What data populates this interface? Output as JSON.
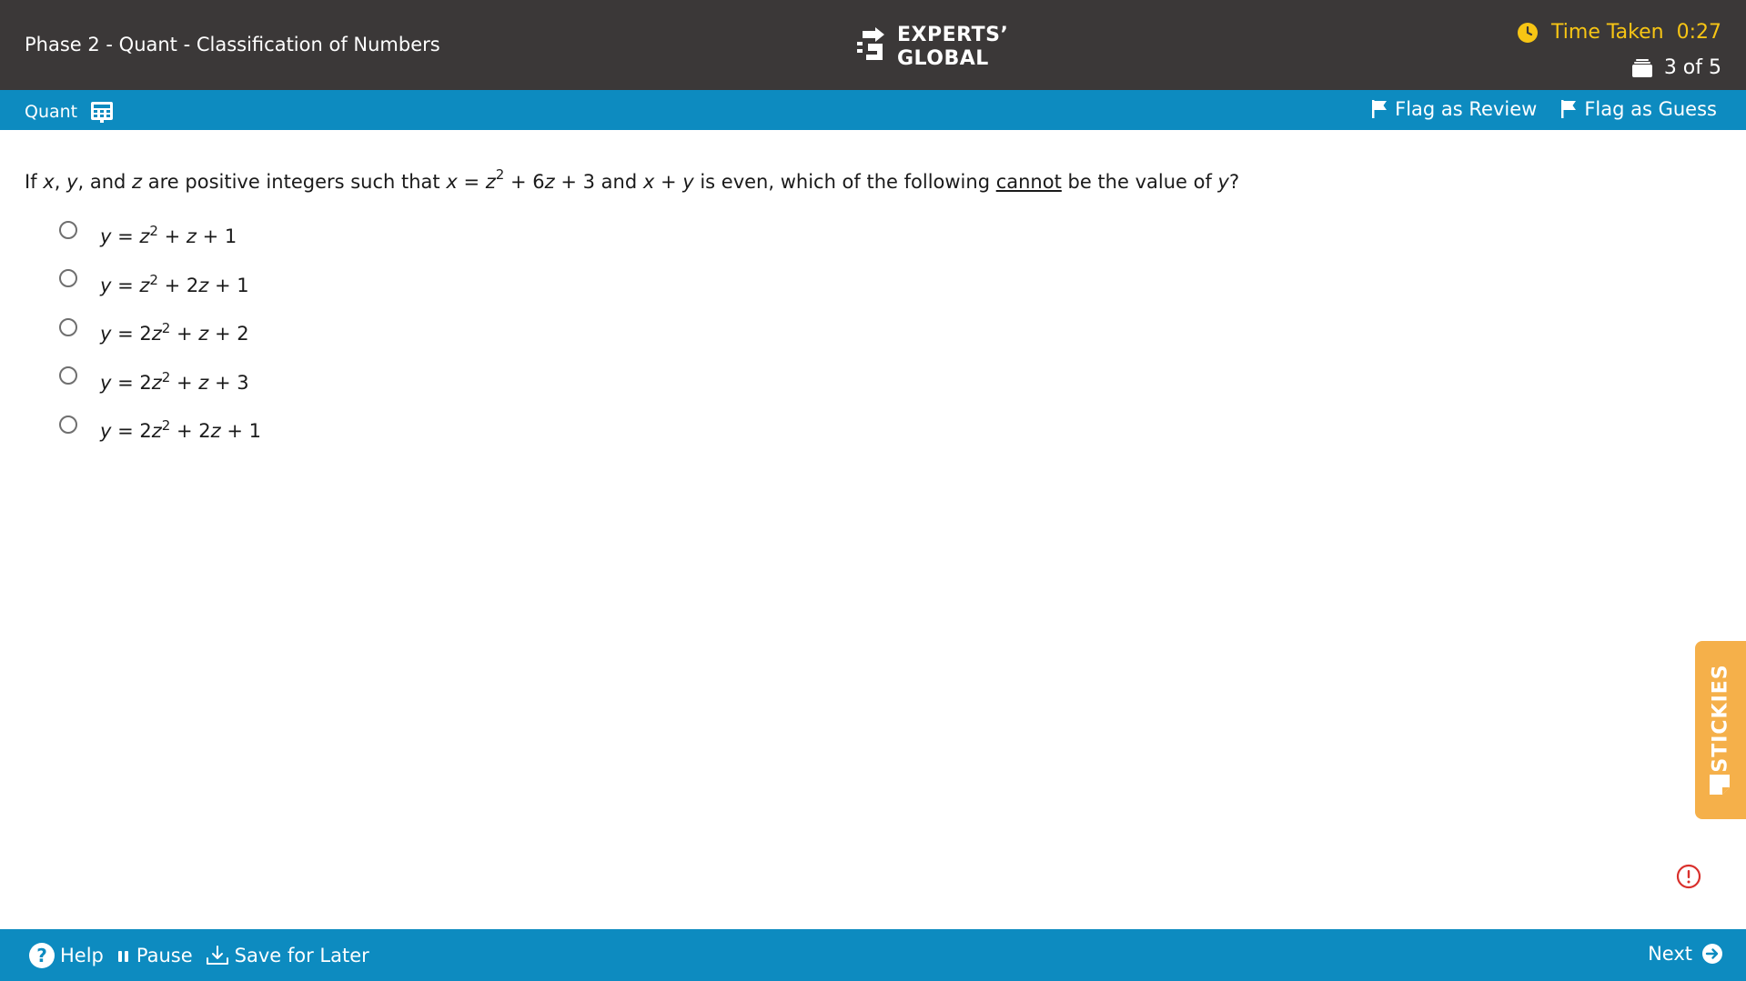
{
  "header": {
    "title": "Phase 2 - Quant - Classification of Numbers",
    "logo": {
      "line1": "EXPERTS’",
      "line2": "GLOBAL",
      "icon": "experts-global-logo-icon"
    },
    "timer": {
      "label": "Time Taken",
      "value": "0:27",
      "icon": "clock-icon",
      "color": "#f7c514"
    },
    "progress": {
      "text": "3 of 5",
      "icon": "question-stack-icon"
    },
    "background": "#3b3838"
  },
  "subbar": {
    "section": "Quant",
    "section_icon": "calculator-icon",
    "flag_review": "Flag as Review",
    "flag_guess": "Flag as Guess",
    "background": "#0d8bc0"
  },
  "question": {
    "p1": "If ",
    "var_x": "x",
    "c1": ", ",
    "var_y": "y",
    "c2": ", and ",
    "var_z": "z",
    "p2": " are positive integers such that ",
    "eq_x": "x",
    "eq_mid": " = ",
    "eq_z": "z",
    "eq_exp": "2",
    "eq_rest1": " + 6",
    "eq_z2": "z",
    "eq_rest2": " + 3 and ",
    "sum_x": "x",
    "sum_plus": " + ",
    "sum_y": "y",
    "p3": " is even, which of the following ",
    "emph": "cannot",
    "p4": " be the value of ",
    "end_y": "y",
    "end": "?"
  },
  "options": [
    {
      "y": "y",
      "eq": " = ",
      "coef": "",
      "z": "z",
      "exp": "2",
      "mid": " + ",
      "coef2": "",
      "z2": "z",
      "tail": " + 1"
    },
    {
      "y": "y",
      "eq": " = ",
      "coef": "",
      "z": "z",
      "exp": "2",
      "mid": " + ",
      "coef2": "2",
      "z2": "z",
      "tail": " + 1"
    },
    {
      "y": "y",
      "eq": " = ",
      "coef": "2",
      "z": "z",
      "exp": "2",
      "mid": " + ",
      "coef2": "",
      "z2": "z",
      "tail": " + 2"
    },
    {
      "y": "y",
      "eq": " = ",
      "coef": "2",
      "z": "z",
      "exp": "2",
      "mid": " + ",
      "coef2": "",
      "z2": "z",
      "tail": " + 3"
    },
    {
      "y": "y",
      "eq": " = ",
      "coef": "2",
      "z": "z",
      "exp": "2",
      "mid": " + ",
      "coef2": "2",
      "z2": "z",
      "tail": " + 1"
    }
  ],
  "stickies": {
    "label": "STICKIES",
    "icon": "sticky-note-icon",
    "color": "#f5b04a"
  },
  "alert": {
    "icon": "alert-circle-icon",
    "color": "#d9302c"
  },
  "footer": {
    "help": "Help",
    "pause": "Pause",
    "save": "Save for Later",
    "next": "Next",
    "background": "#0d8bc0"
  }
}
